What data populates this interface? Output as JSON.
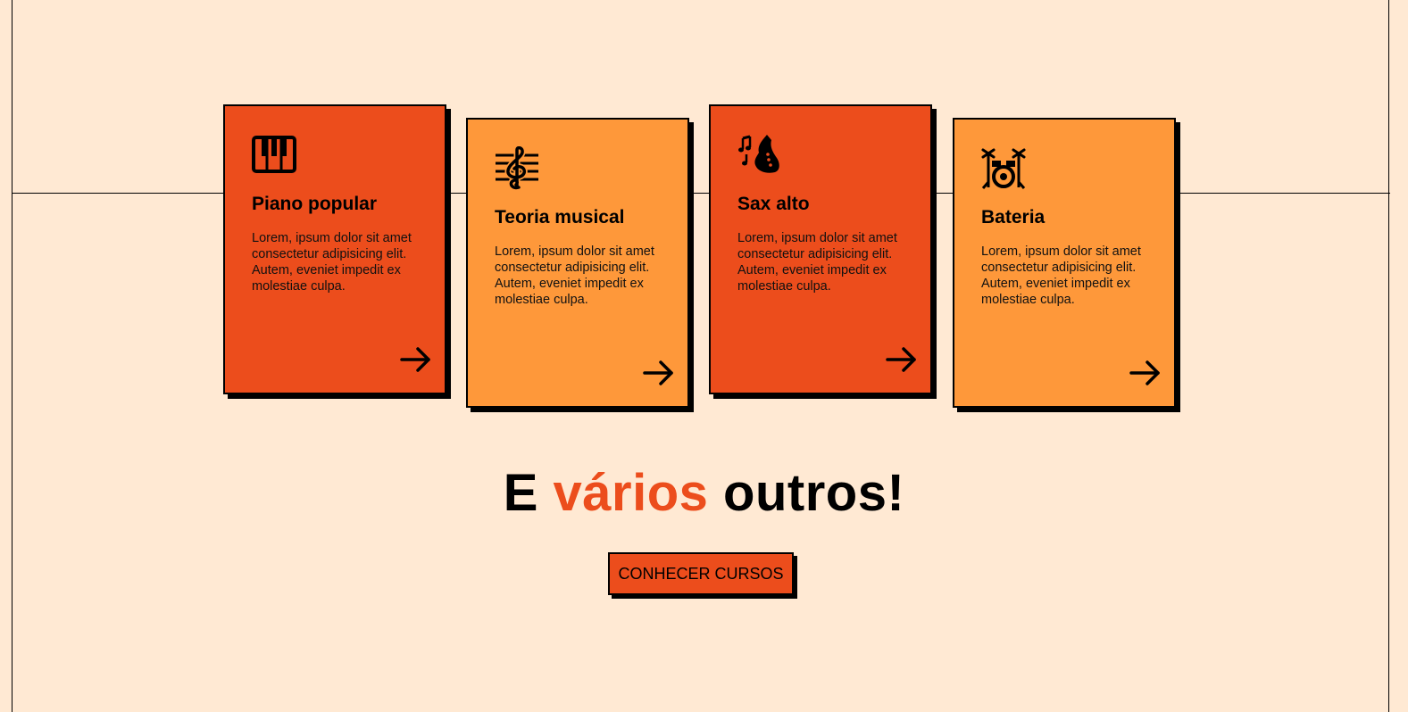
{
  "colors": {
    "background": "#FFE9D3",
    "red": "#EC4D1C",
    "orange": "#FE983A",
    "ink": "#000000"
  },
  "courses": [
    {
      "title": "Piano popular",
      "description": "Lorem, ipsum dolor sit amet consectetur adipisicing elit. Autem, eveniet impedit ex molestiae culpa.",
      "icon": "piano-icon",
      "color": "red"
    },
    {
      "title": "Teoria musical",
      "description": "Lorem, ipsum dolor sit amet consectetur adipisicing elit. Autem, eveniet impedit ex molestiae culpa.",
      "icon": "treble-clef-icon",
      "color": "orange"
    },
    {
      "title": "Sax alto",
      "description": "Lorem, ipsum dolor sit amet consectetur adipisicing elit. Autem, eveniet impedit ex molestiae culpa.",
      "icon": "saxophone-icon",
      "color": "red"
    },
    {
      "title": "Bateria",
      "description": "Lorem, ipsum dolor sit amet consectetur adipisicing elit. Autem, eveniet impedit ex molestiae culpa.",
      "icon": "drum-kit-icon",
      "color": "orange"
    }
  ],
  "headline": {
    "before": "E ",
    "accent": "vários",
    "after": " outros!"
  },
  "cta": {
    "label": "CONHECER CURSOS"
  }
}
